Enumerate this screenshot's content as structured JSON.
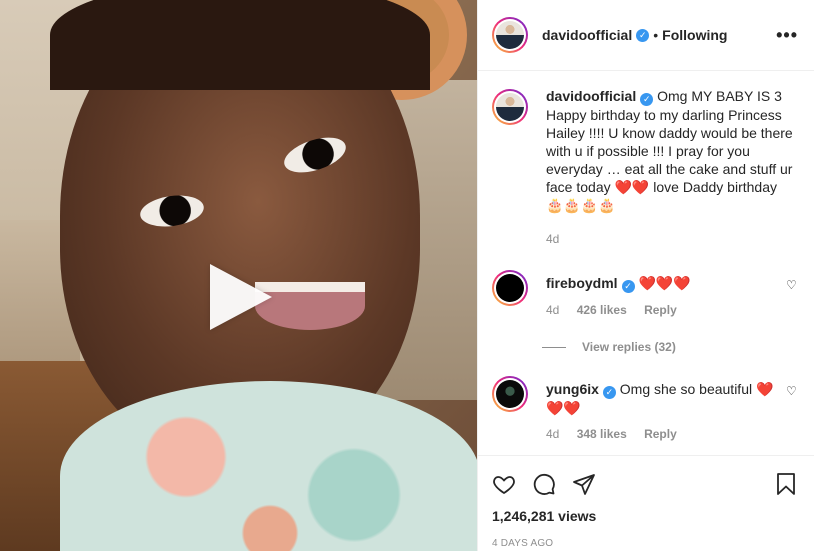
{
  "post": {
    "author": "davidoofficial",
    "follow_status": "Following",
    "more_glyph": "•••",
    "caption": "Omg MY BABY IS 3 Happy birthday to my darling Princess Hailey !!!! U know daddy would be there with u if possible !!! I pray for you everyday … eat all the cake and stuff ur face today ❤️❤️ love Daddy birthday 🎂🎂🎂🎂",
    "caption_age": "4d",
    "views": "1,246,281 views",
    "posted": "4 DAYS AGO"
  },
  "comments": [
    {
      "username": "fireboydml",
      "text": "❤️❤️❤️",
      "age": "4d",
      "likes": "426 likes",
      "reply": "Reply",
      "view_replies": "View replies (32)"
    },
    {
      "username": "yung6ix",
      "text": "Omg she so beautiful ❤️❤️❤️",
      "age": "4d",
      "likes": "348 likes",
      "reply": "Reply"
    }
  ],
  "icons": {
    "play": "play-icon",
    "like": "heart-icon",
    "comment": "comment-icon",
    "share": "paper-plane-icon",
    "save": "bookmark-icon",
    "verified": "verified-badge-icon"
  },
  "colors": {
    "verified": "#3897f0",
    "heart": "#ed4956",
    "muted": "#8e8e8e"
  }
}
